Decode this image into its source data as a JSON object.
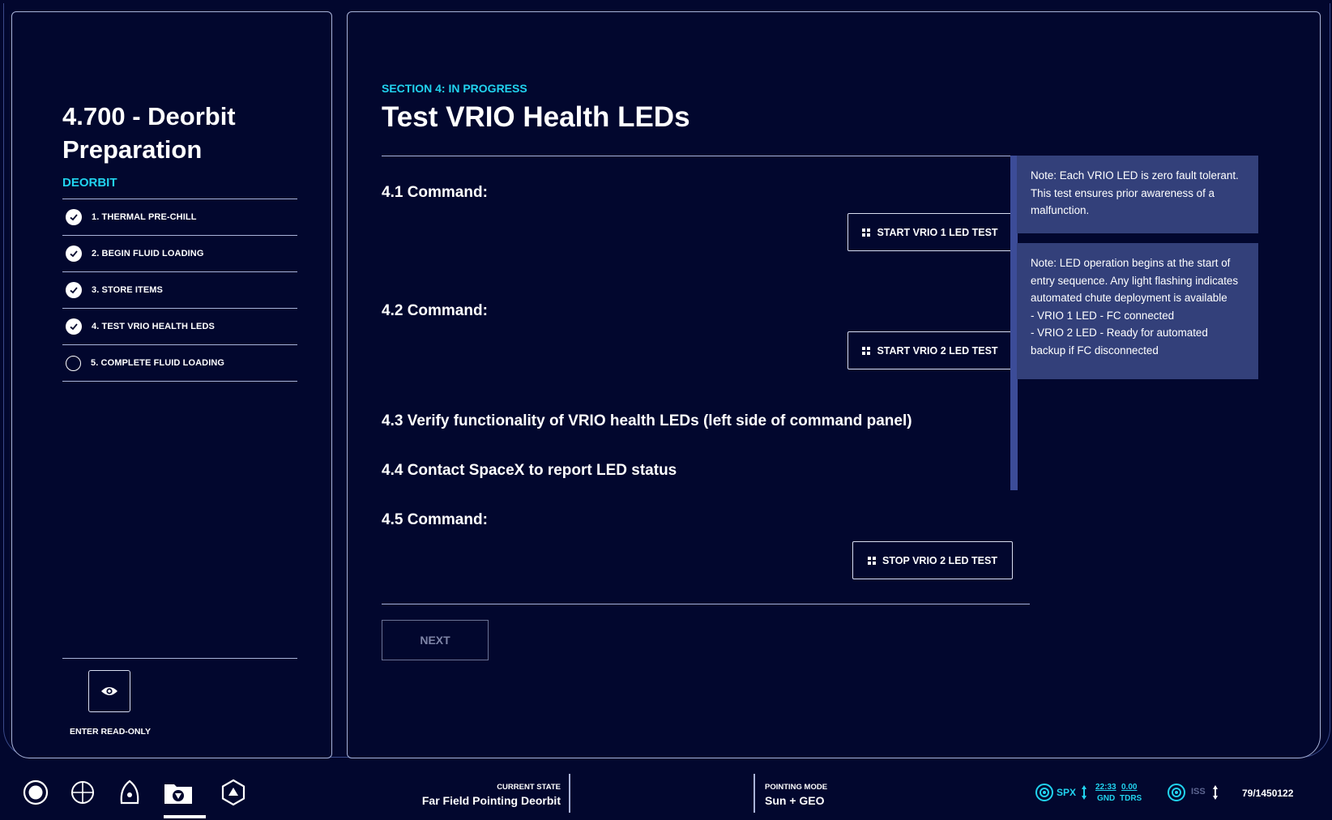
{
  "procedure": {
    "title": "4.700 - Deorbit Preparation",
    "tag": "DEORBIT",
    "steps": [
      {
        "label": "1. THERMAL PRE-CHILL",
        "status": "done"
      },
      {
        "label": "2. BEGIN FLUID LOADING",
        "status": "done"
      },
      {
        "label": "3. STORE ITEMS",
        "status": "done"
      },
      {
        "label": "4. TEST VRIO HEALTH LEDS",
        "status": "done"
      },
      {
        "label": "5. COMPLETE FLUID LOADING",
        "status": "pending"
      }
    ],
    "read_only_label": "ENTER READ-ONLY"
  },
  "section": {
    "status": "SECTION 4: IN PROGRESS",
    "title": "Test VRIO Health LEDs",
    "items": {
      "c1": "4.1 Command:",
      "c2": "4.2 Command:",
      "c3": "4.3 Verify functionality of VRIO health LEDs (left side of command panel)",
      "c4": "4.4 Contact SpaceX to report LED status",
      "c5": "4.5 Command:"
    },
    "buttons": {
      "start1": "START VRIO 1 LED TEST",
      "start2": "START VRIO 2 LED TEST",
      "stop2": "STOP VRIO 2 LED TEST",
      "next": "NEXT"
    },
    "notes": [
      "Note: Each VRIO LED is zero fault tolerant. This test ensures prior awareness of a malfunction.",
      "Note: LED operation begins at the start of entry sequence. Any light flashing indicates automated chute deployment is available\n- VRIO 1 LED - FC connected\n- VRIO 2 LED - Ready for automated backup if FC disconnected"
    ]
  },
  "status_bar": {
    "current_state_label": "CURRENT STATE",
    "current_state_value": "Far Field Pointing Deorbit",
    "pointing_mode_label": "POINTING MODE",
    "pointing_mode_value": "Sun + GEO",
    "spx_label": "SPX",
    "time_value": "22:33",
    "time_label": "GND",
    "tdrs_value": "0.00",
    "tdrs_label": "TDRS",
    "iss_label": "ISS",
    "counter": "79/1450122",
    "accent_color": "#21d3ef"
  }
}
